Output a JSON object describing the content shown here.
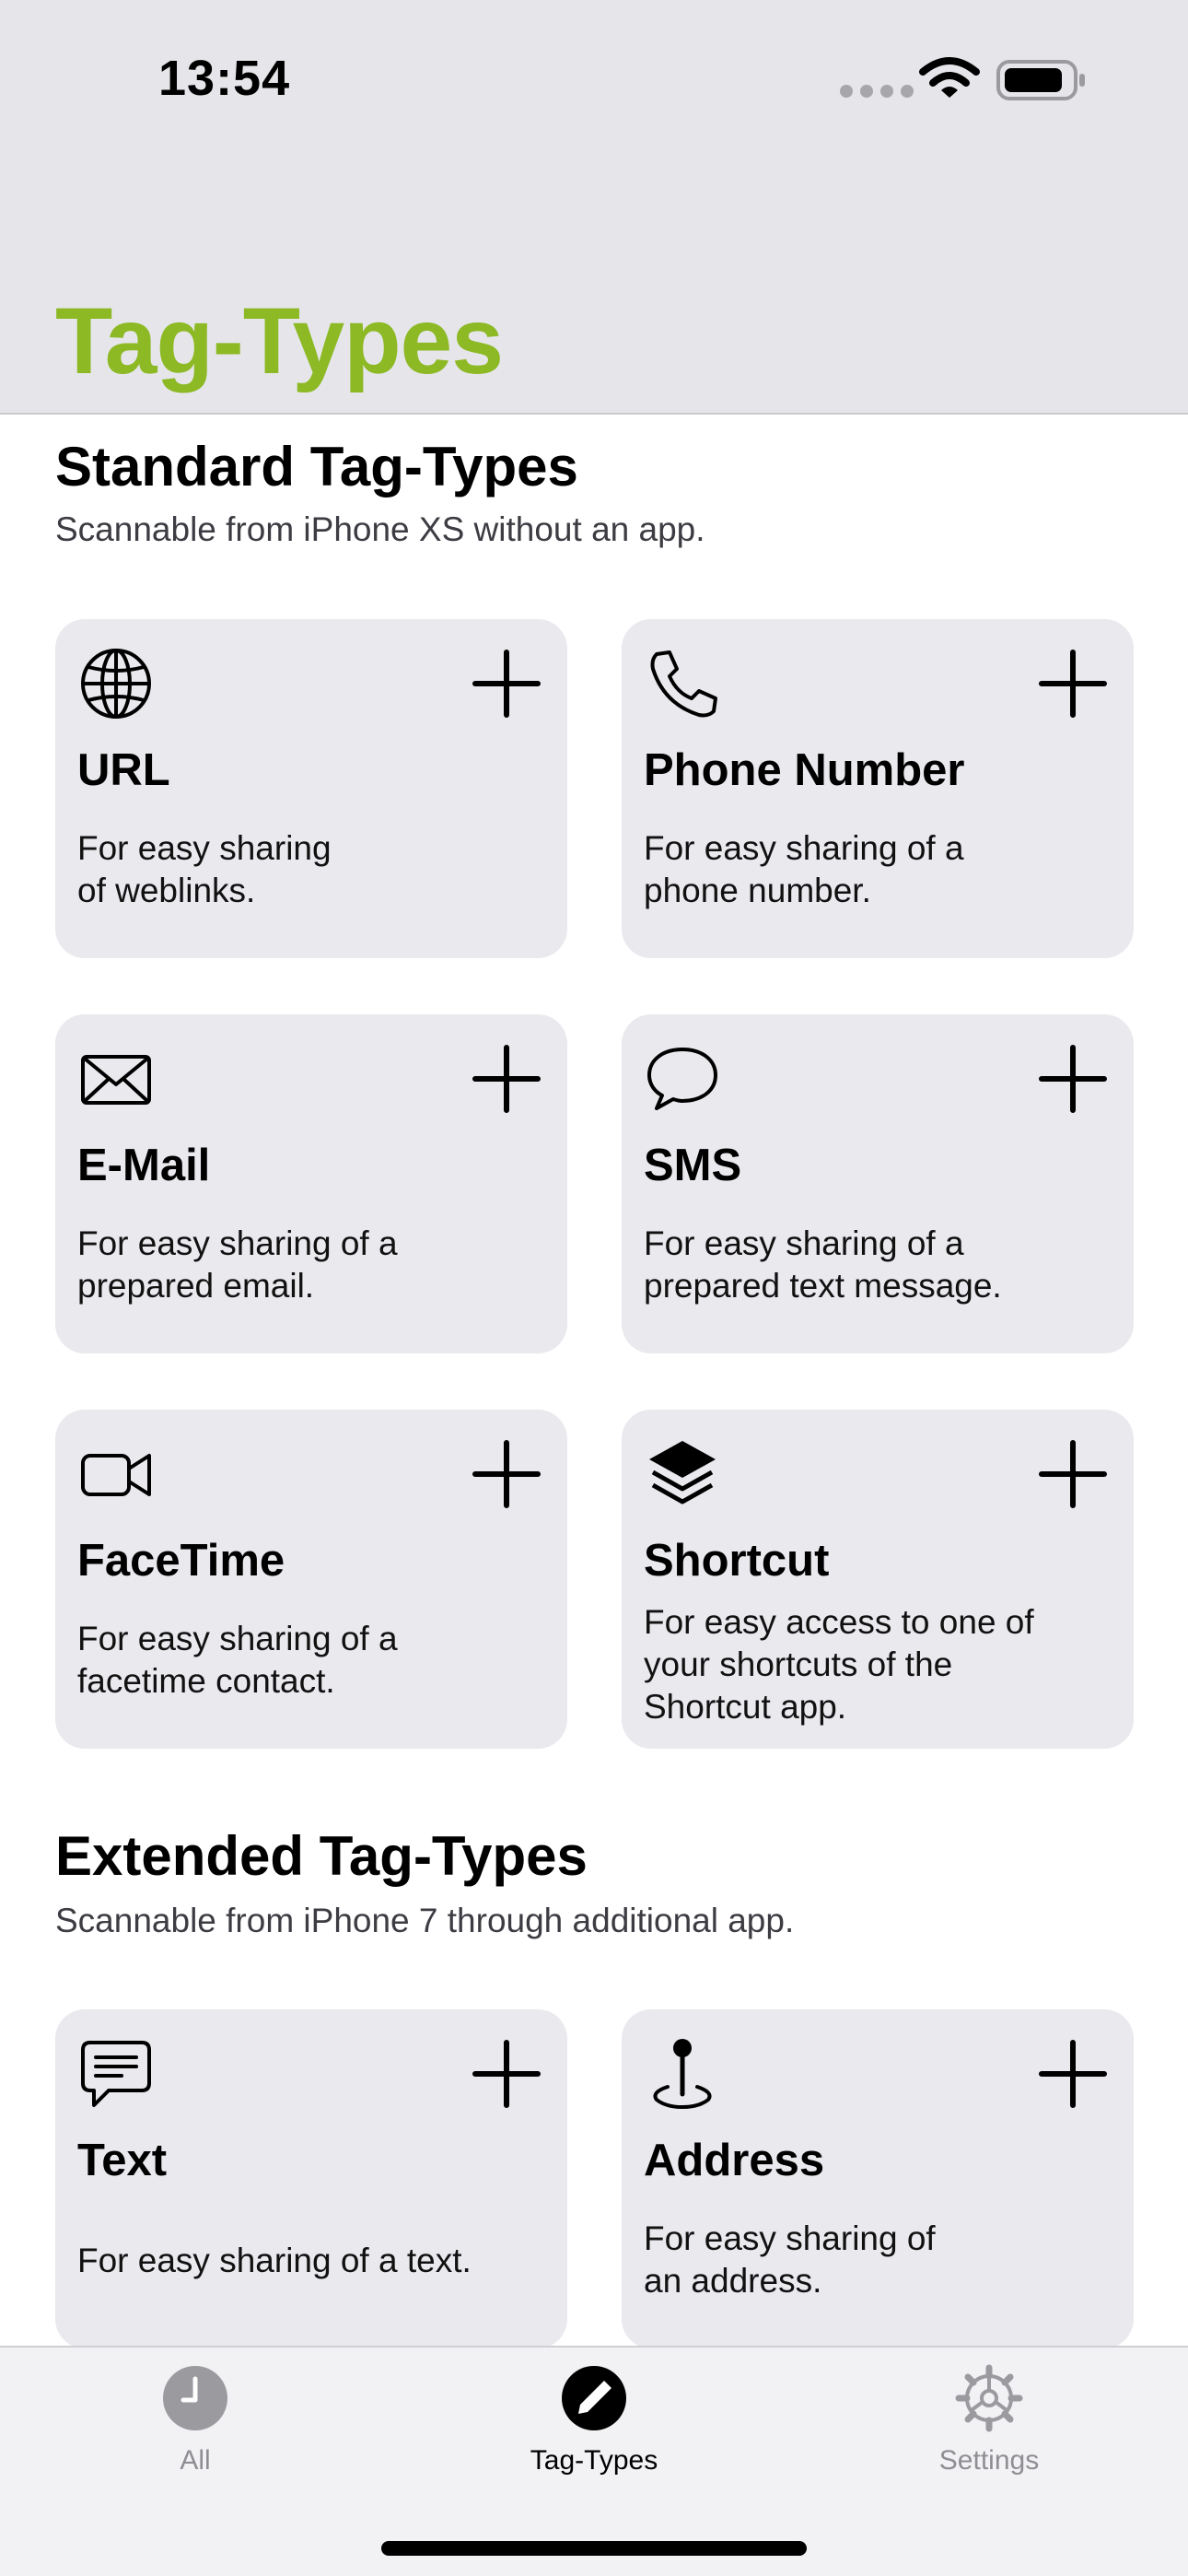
{
  "status_bar": {
    "time": "13:54"
  },
  "header": {
    "title": "Tag-Types"
  },
  "standard": {
    "title": "Standard Tag-Types",
    "subtitle": "Scannable from iPhone XS without an app.",
    "cards": [
      {
        "icon": "globe-icon",
        "title": "URL",
        "desc_lines": [
          "For easy sharing",
          "of weblinks."
        ]
      },
      {
        "icon": "phone-icon",
        "title": "Phone Number",
        "desc_lines": [
          "For easy sharing of a",
          "phone number."
        ]
      },
      {
        "icon": "envelope-icon",
        "title": "E-Mail",
        "desc_lines": [
          "For easy sharing of a",
          "prepared email."
        ]
      },
      {
        "icon": "speech-bubble-icon",
        "title": "SMS",
        "desc_lines": [
          "For easy sharing of a",
          "prepared text message."
        ]
      },
      {
        "icon": "video-camera-icon",
        "title": "FaceTime",
        "desc_lines": [
          "For easy sharing of a",
          "facetime contact."
        ]
      },
      {
        "icon": "layers-icon",
        "title": "Shortcut",
        "desc_lines": [
          "For easy access to one of",
          "your shortcuts of the",
          "Shortcut app."
        ]
      }
    ]
  },
  "extended": {
    "title": "Extended Tag-Types",
    "subtitle": "Scannable from iPhone 7 through additional app.",
    "cards": [
      {
        "icon": "text-bubble-icon",
        "title": "Text",
        "desc_lines": [
          "For easy sharing of a text."
        ]
      },
      {
        "icon": "map-pin-icon",
        "title": "Address",
        "desc_lines": [
          "For easy sharing of",
          "an address."
        ]
      }
    ]
  },
  "tabbar": {
    "tabs": [
      {
        "label": "All",
        "icon": "clock-icon",
        "active": false
      },
      {
        "label": "Tag-Types",
        "icon": "pencil-icon",
        "active": true
      },
      {
        "label": "Settings",
        "icon": "gear-icon",
        "active": false
      }
    ]
  },
  "colors": {
    "accent": "#8db925",
    "header_bg": "#e6e6ea",
    "card_bg": "#e9e9ee",
    "tab_inactive": "#8e8e93"
  }
}
